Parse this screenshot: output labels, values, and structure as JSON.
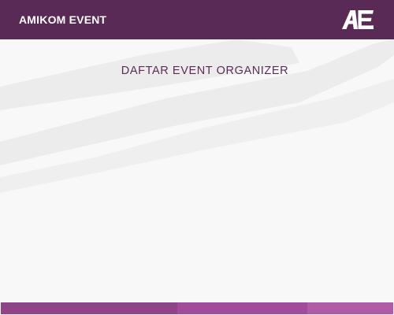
{
  "header": {
    "title": "AMIKOM EVENT",
    "logo_icon": "ae-logo-icon"
  },
  "main": {
    "page_title": "DAFTAR EVENT ORGANIZER"
  },
  "colors": {
    "header_bg": "#582a55",
    "title_text": "#5b2c57",
    "background": "#f8f8f8",
    "stripe": "#ececec",
    "footer_1": "#8e4487",
    "footer_2": "#a24b9c",
    "footer_3": "#b05aa8"
  }
}
